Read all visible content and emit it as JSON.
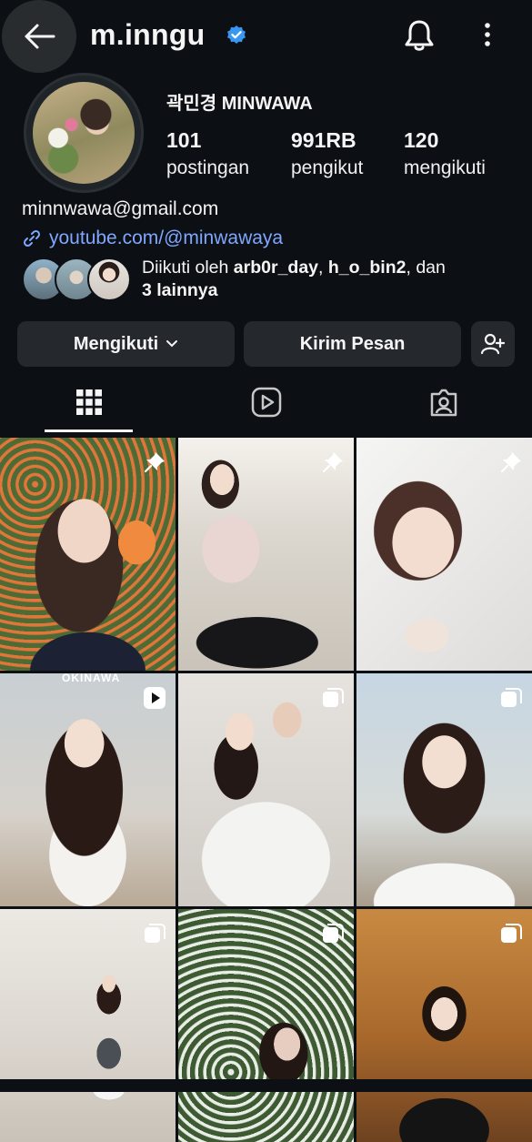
{
  "header": {
    "username": "m.inngu",
    "verified": true,
    "icons": [
      "back-arrow-icon",
      "verified-badge-icon",
      "bell-icon",
      "more-vertical-icon"
    ]
  },
  "profile": {
    "full_name": "곽민경 MINWAWA",
    "stats": [
      {
        "value": "101",
        "label": "postingan"
      },
      {
        "value": "991RB",
        "label": "pengikut"
      },
      {
        "value": "120",
        "label": "mengikuti"
      }
    ],
    "email": "minnwawa@gmail.com",
    "link": "youtube.com/@minwawaya",
    "followed_by": {
      "prefix": "Diikuti oleh ",
      "user1": "arb0r_day",
      "sep": ", ",
      "user2": "h_o_bin2",
      "mid": ", dan ",
      "others": "3 lainnya"
    }
  },
  "actions": {
    "follow_label": "Mengikuti",
    "message_label": "Kirim Pesan"
  },
  "tabs": [
    "grid-icon",
    "reels-icon",
    "tagged-icon"
  ],
  "colors": {
    "background": "#0c1014",
    "button": "#25292e",
    "link": "#7fa7ff",
    "verified": "#3897f0"
  },
  "posts": [
    {
      "badge": "pin-icon"
    },
    {
      "badge": "pin-icon"
    },
    {
      "badge": "pin-icon"
    },
    {
      "badge": "reel-icon",
      "overlay_text": "OKINAWA"
    },
    {
      "badge": "carousel-icon"
    },
    {
      "badge": "carousel-icon"
    },
    {
      "badge": "carousel-icon"
    },
    {
      "badge": "carousel-icon"
    },
    {
      "badge": "carousel-icon"
    }
  ]
}
